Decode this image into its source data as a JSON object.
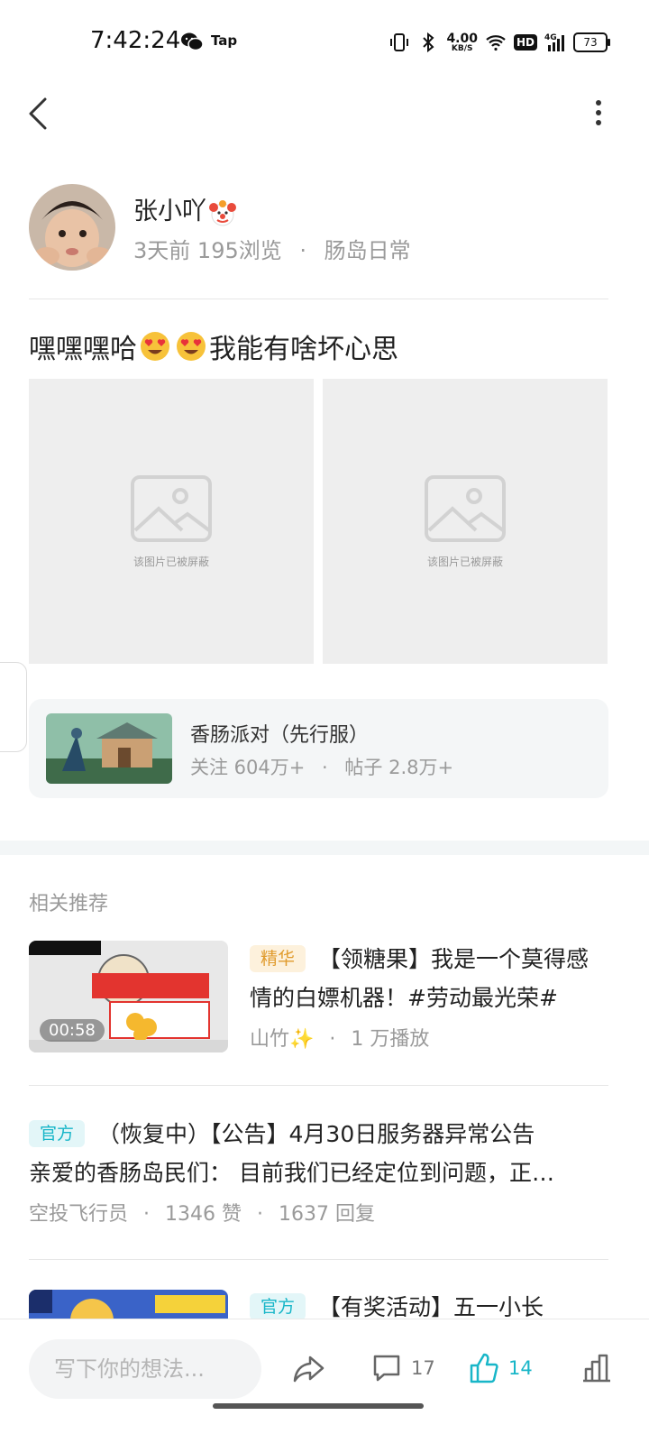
{
  "status": {
    "time": "7:42:24",
    "tap_label": "Tap",
    "net_speed_value": "4.00",
    "net_speed_unit": "KB/S",
    "hd": "HD",
    "signal": "4G",
    "battery": "73"
  },
  "author": {
    "name": "张小吖",
    "time_ago": "3天前",
    "views": "195浏览",
    "category": "肠岛日常"
  },
  "post": {
    "title_a": "嘿嘿嘿哈",
    "title_b": "我能有啥坏心思",
    "image_blocked_text": "该图片已被屏蔽"
  },
  "game": {
    "name": "香肠派对（先行服）",
    "followers": "关注 604万+",
    "posts": "帖子 2.8万+"
  },
  "section_title": "相关推荐",
  "recommendations": [
    {
      "tag": "精华",
      "title": "【领糖果】我是一个莫得感情的白嫖机器！#劳动最光荣#",
      "author": "山竹✨",
      "stat": "1 万播放",
      "duration": "00:58"
    },
    {
      "tag": "官方",
      "title_line1": "（恢复中）【公告】4月30日服务器异常公告",
      "title_line2": "亲爱的香肠岛民们： 目前我们已经定位到问题，正…",
      "author": "空投飞行员",
      "likes": "1346 赞",
      "replies": "1637 回复"
    },
    {
      "tag": "官方",
      "title": "【有奖活动】五一小长"
    }
  ],
  "bottom_bar": {
    "input_placeholder": "写下你的想法...",
    "comment_count": "17",
    "like_count": "14"
  },
  "colors": {
    "accent": "#18b6c8",
    "tag_gold": "#e09b2d",
    "muted_text": "#9a9a9a"
  }
}
